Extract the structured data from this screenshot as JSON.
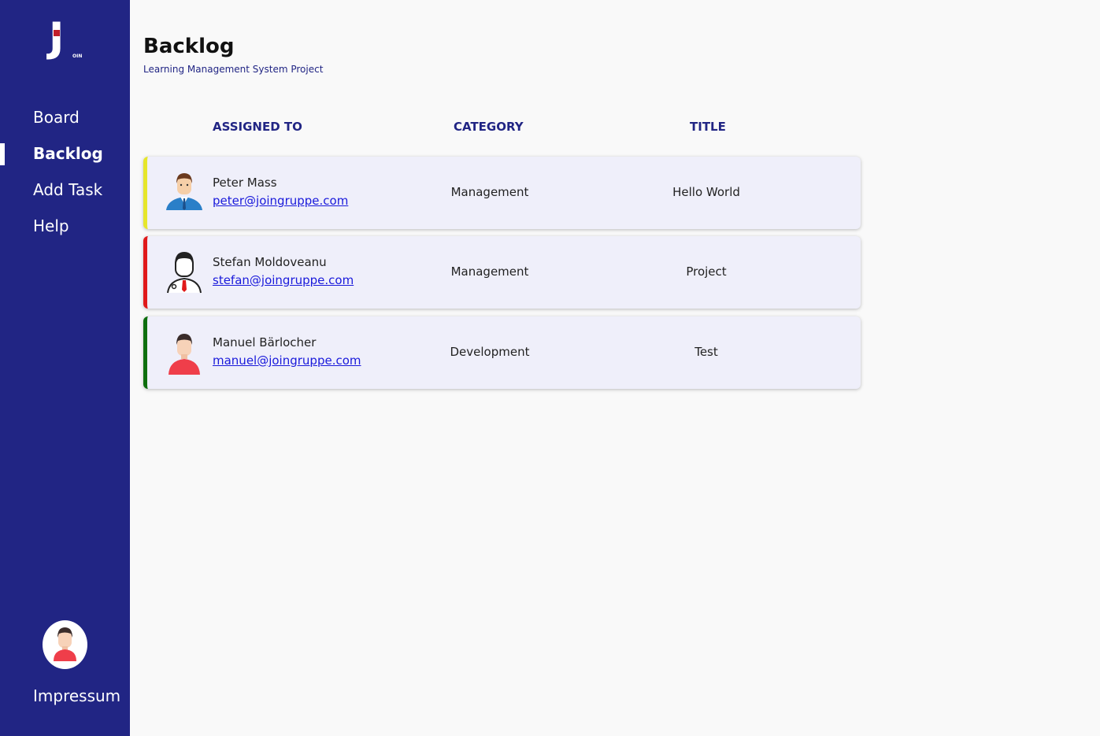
{
  "logo": {
    "letter": "J",
    "suffix": "OIN"
  },
  "nav": {
    "items": [
      {
        "label": "Board"
      },
      {
        "label": "Backlog"
      },
      {
        "label": "Add Task"
      },
      {
        "label": "Help"
      }
    ],
    "active": "Backlog"
  },
  "footer": {
    "impressum_label": "Impressum"
  },
  "page": {
    "title": "Backlog",
    "subtitle": "Learning Management System Project"
  },
  "table": {
    "headers": {
      "assigned": "ASSIGNED TO",
      "category": "CATEGORY",
      "title": "TITLE"
    },
    "rows": [
      {
        "name": "Peter Mass",
        "email": "peter@joingruppe.com",
        "category": "Management",
        "title": "Hello World",
        "color": "#e6e62a"
      },
      {
        "name": "Stefan Moldoveanu",
        "email": "stefan@joingruppe.com",
        "category": "Management",
        "title": "Project",
        "color": "#e01919"
      },
      {
        "name": "Manuel Bärlocher",
        "email": "manuel@joingruppe.com",
        "category": "Development",
        "title": "Test",
        "color": "#0d6e0d"
      }
    ]
  },
  "colors": {
    "sidebar": "#212584",
    "accent": "#212584",
    "link": "#1a1adb"
  }
}
